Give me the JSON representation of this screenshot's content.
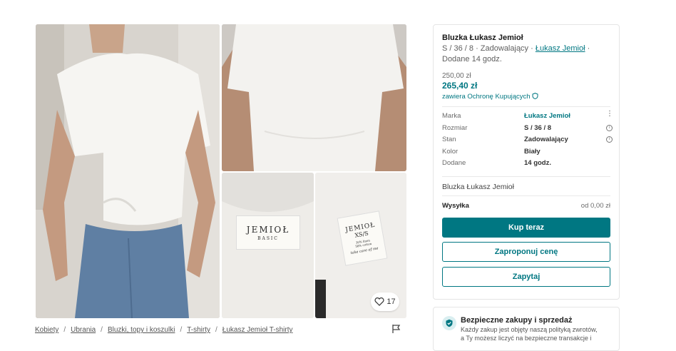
{
  "photos": {
    "like_count": "17",
    "tag_left": {
      "brand": "JEMIOŁ",
      "line": "BASIC"
    },
    "tag_right": {
      "brand": "JEMIOŁ",
      "size": "XS/S",
      "care1": "30% linen",
      "care2": "58% cotton",
      "note": "take care of me"
    }
  },
  "breadcrumb": [
    "Kobiety",
    "Ubrania",
    "Bluzki, topy i koszulki",
    "T-shirty",
    "Łukasz Jemioł T-shirty"
  ],
  "breadcrumb_sep": "/",
  "product": {
    "title": "Bluzka Łukasz Jemioł",
    "subtitle_prefix": "S / 36 / 8 · Zadowalający · ",
    "brand_link": "Łukasz Jemioł",
    "subtitle_suffix": " ·",
    "added": "Dodane 14 godz.",
    "old_price": "250,00 zł",
    "price": "265,40 zł",
    "protection": "zawiera Ochronę Kupujących",
    "details": [
      {
        "label": "Marka",
        "value": "Łukasz Jemioł",
        "link": true
      },
      {
        "label": "Rozmiar",
        "value": "S / 36 / 8"
      },
      {
        "label": "Stan",
        "value": "Zadowalający"
      },
      {
        "label": "Kolor",
        "value": "Biały"
      },
      {
        "label": "Dodane",
        "value": "14 godz."
      }
    ],
    "description": "Bluzka Łukasz Jemioł",
    "shipping_label": "Wysyłka",
    "shipping_value": "od 0,00 zł",
    "buy_now": "Kup teraz",
    "make_offer": "Zaproponuj cenę",
    "ask": "Zapytaj"
  },
  "safety": {
    "title": "Bezpieczne zakupy i sprzedaż",
    "text1": "Każdy zakup jest objęty naszą polityką zwrotów,",
    "text2": "a Ty możesz liczyć na bezpieczne transakcje i"
  },
  "colors": {
    "accent": "#007782"
  }
}
